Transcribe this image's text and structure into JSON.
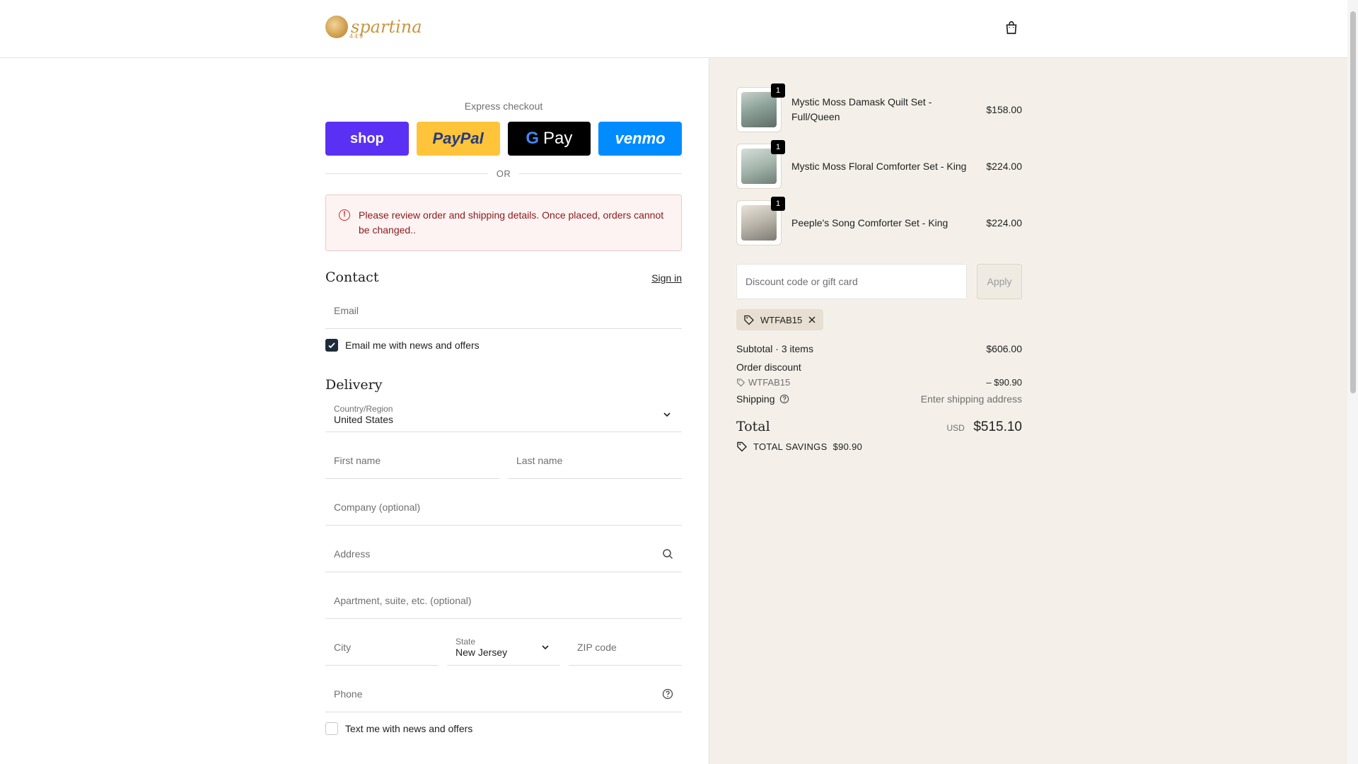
{
  "brand": {
    "name": "spartina",
    "sub": "449"
  },
  "express": {
    "title": "Express checkout",
    "buttons": {
      "shop": "shop",
      "paypal": "PayPal",
      "gpay_g": "G",
      "gpay": "Pay",
      "venmo": "venmo"
    },
    "or": "OR"
  },
  "alert": {
    "text": "Please review order and shipping details. Once placed, orders cannot be changed.."
  },
  "contact": {
    "title": "Contact",
    "sign_in": "Sign in",
    "email_placeholder": "Email",
    "newsletter": "Email me with news and offers",
    "newsletter_checked": true
  },
  "delivery": {
    "title": "Delivery",
    "country_label": "Country/Region",
    "country_value": "United States",
    "first_name": "First name",
    "last_name": "Last name",
    "company": "Company (optional)",
    "address": "Address",
    "apartment": "Apartment, suite, etc. (optional)",
    "city": "City",
    "state_label": "State",
    "state_value": "New Jersey",
    "zip": "ZIP code",
    "phone": "Phone",
    "sms": "Text me with news and offers",
    "sms_checked": false
  },
  "cart": {
    "items": [
      {
        "name": "Mystic Moss Damask Quilt Set - Full/Queen",
        "price": "$158.00",
        "qty": "1"
      },
      {
        "name": "Mystic Moss Floral Comforter Set - King",
        "price": "$224.00",
        "qty": "1"
      },
      {
        "name": "Peeple's Song Comforter Set - King",
        "price": "$224.00",
        "qty": "1"
      }
    ],
    "discount_placeholder": "Discount code or gift card",
    "apply": "Apply",
    "applied_code": "WTFAB15"
  },
  "totals": {
    "subtotal_label": "Subtotal · 3 items",
    "subtotal": "$606.00",
    "order_discount_label": "Order discount",
    "discount_code": "WTFAB15",
    "discount_value": "– $90.90",
    "shipping_label": "Shipping",
    "shipping_value": "Enter shipping address",
    "total_label": "Total",
    "currency": "USD",
    "total": "$515.10",
    "savings_label": "TOTAL SAVINGS",
    "savings_value": "$90.90"
  },
  "colors": {
    "shop": "#5a31f4",
    "paypal": "#ffc439",
    "venmo": "#008cff",
    "summary_bg": "#f4f0e9",
    "accent_dark": "#1d2b3a"
  }
}
